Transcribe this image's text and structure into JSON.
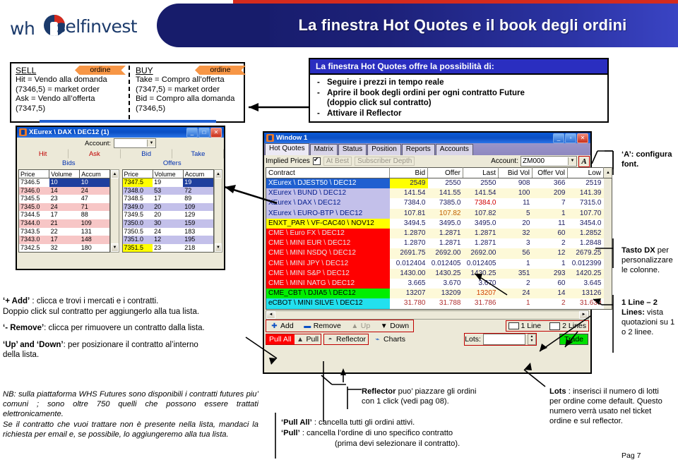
{
  "header": {
    "title": "La finestra Hot Quotes e il book degli ordini",
    "logo_wh": "wh",
    "logo_self": "selfinvest"
  },
  "sellbuy": {
    "left": {
      "heading": "SELL",
      "badge": "ordine",
      "lines": [
        "Hit = Vendo alla domanda",
        "(7346,5) = market order",
        "Ask = Vendo all’offerta",
        "(7347,5)"
      ]
    },
    "right": {
      "heading": "BUY",
      "badge": "ordine",
      "lines": [
        "Take = Compro all’offerta",
        "(7347,5) = market order",
        "Bid = Compro alla domanda",
        "(7346,5)"
      ]
    }
  },
  "infobox": {
    "title": "La finestra Hot Quotes offre la possibilità di:",
    "items": [
      "Seguire i prezzi in tempo reale",
      "Aprire il book degli ordini per ogni contratto Future",
      "(doppio click sul contratto)",
      "Attivare il Reflector"
    ]
  },
  "dax_window": {
    "title": "XEurex \\ DAX \\ DEC12 (1)",
    "min_label": "_",
    "max_label": "□",
    "close_label": "✕",
    "account_label": "Account:",
    "account_value": "",
    "action_buttons": [
      "Hit",
      "Ask",
      "Bid",
      "Take"
    ],
    "bids_label": "Bids",
    "offers_label": "Offers",
    "columns": [
      "Price",
      "Volume",
      "Accum"
    ],
    "bids": [
      {
        "price": "7346.5",
        "volume": "10",
        "accum": "10"
      },
      {
        "price": "7346.0",
        "volume": "14",
        "accum": "24"
      },
      {
        "price": "7345.5",
        "volume": "23",
        "accum": "47"
      },
      {
        "price": "7345.0",
        "volume": "24",
        "accum": "71"
      },
      {
        "price": "7344.5",
        "volume": "17",
        "accum": "88"
      },
      {
        "price": "7344.0",
        "volume": "21",
        "accum": "109"
      },
      {
        "price": "7343.5",
        "volume": "22",
        "accum": "131"
      },
      {
        "price": "7343.0",
        "volume": "17",
        "accum": "148"
      },
      {
        "price": "7342.5",
        "volume": "32",
        "accum": "180"
      }
    ],
    "offers": [
      {
        "price": "7347.5",
        "volume": "19",
        "accum": "19"
      },
      {
        "price": "7348.0",
        "volume": "53",
        "accum": "72"
      },
      {
        "price": "7348.5",
        "volume": "17",
        "accum": "89"
      },
      {
        "price": "7349.0",
        "volume": "20",
        "accum": "109"
      },
      {
        "price": "7349.5",
        "volume": "20",
        "accum": "129"
      },
      {
        "price": "7350.0",
        "volume": "30",
        "accum": "159"
      },
      {
        "price": "7350.5",
        "volume": "24",
        "accum": "183"
      },
      {
        "price": "7351.0",
        "volume": "12",
        "accum": "195"
      },
      {
        "price": "7351.5",
        "volume": "23",
        "accum": "218"
      }
    ]
  },
  "hot_quotes": {
    "title": "Window 1",
    "tabs": [
      "Hot Quotes",
      "Matrix",
      "Status",
      "Position",
      "Reports",
      "Accounts"
    ],
    "active_tab": "Hot Quotes",
    "implied_prices_label": "Implied Prices",
    "at_best_label": "At Best",
    "subscriber_depth_label": "Subscriber Depth",
    "account_label": "Account:",
    "account_value": "ZM000",
    "font_button": "A",
    "columns": [
      "Contract",
      "Bid",
      "Offer",
      "Last",
      "Bid Vol",
      "Offer Vol",
      "Low"
    ],
    "rows": [
      {
        "contract": "XEurex \\ DJEST50 \\ DEC12",
        "bid": "2549",
        "offer": "2550",
        "last": "2550",
        "bidvol": "908",
        "offervol": "366",
        "low": "2519",
        "color": "selected"
      },
      {
        "contract": "XEurex \\ BUND \\ DEC12",
        "bid": "141.54",
        "offer": "141.55",
        "last": "141.54",
        "bidvol": "100",
        "offervol": "209",
        "low": "141.39",
        "color": "lavender"
      },
      {
        "contract": "XEurex \\ DAX \\ DEC12",
        "bid": "7384.0",
        "offer": "7385.0",
        "last": "7384.0",
        "bidvol": "11",
        "offervol": "7",
        "low": "7315.0",
        "color": "lavender"
      },
      {
        "contract": "XEurex \\ EURO-BTP \\ DEC12",
        "bid": "107.81",
        "offer": "107.82",
        "last": "107.82",
        "bidvol": "5",
        "offervol": "1",
        "low": "107.70",
        "color": "lavender"
      },
      {
        "contract": "ENXT_PAR \\ VF-CAC40 \\ NOV12",
        "bid": "3494.5",
        "offer": "3495.0",
        "last": "3495.0",
        "bidvol": "20",
        "offervol": "11",
        "low": "3454.0",
        "color": "yellow"
      },
      {
        "contract": "CME \\ Euro FX \\ DEC12",
        "bid": "1.2870",
        "offer": "1.2871",
        "last": "1.2871",
        "bidvol": "32",
        "offervol": "60",
        "low": "1.2852",
        "color": "red"
      },
      {
        "contract": "CME \\ MINI EUR \\ DEC12",
        "bid": "1.2870",
        "offer": "1.2871",
        "last": "1.2871",
        "bidvol": "3",
        "offervol": "2",
        "low": "1.2848",
        "color": "red"
      },
      {
        "contract": "CME \\ MINI NSDQ \\ DEC12",
        "bid": "2691.75",
        "offer": "2692.00",
        "last": "2692.00",
        "bidvol": "56",
        "offervol": "12",
        "low": "2679.25",
        "color": "red"
      },
      {
        "contract": "CME \\ MINI JPY \\ DEC12",
        "bid": "0.012404",
        "offer": "0.012405",
        "last": "0.012405",
        "bidvol": "1",
        "offervol": "1",
        "low": "0.012399",
        "color": "red"
      },
      {
        "contract": "CME \\ MINI S&P \\ DEC12",
        "bid": "1430.00",
        "offer": "1430.25",
        "last": "1430.25",
        "bidvol": "351",
        "offervol": "293",
        "low": "1420.25",
        "color": "red"
      },
      {
        "contract": "CME \\ MINI NATG \\ DEC12",
        "bid": "3.665",
        "offer": "3.670",
        "last": "3.670",
        "bidvol": "2",
        "offervol": "60",
        "low": "3.645",
        "color": "red"
      },
      {
        "contract": "CME_CBT \\ DJIA5 \\ DEC12",
        "bid": "13207",
        "offer": "13209",
        "last": "13207",
        "bidvol": "24",
        "offervol": "14",
        "low": "13126",
        "color": "green"
      },
      {
        "contract": "eCBOT \\ MINI SILVE \\ DEC12",
        "bid": "31.780",
        "offer": "31.788",
        "last": "31.786",
        "bidvol": "1",
        "offervol": "2",
        "low": "31.630",
        "color": "cyan"
      }
    ],
    "toolbar_top": [
      {
        "icon": "plus-icon",
        "label": "Add",
        "disabled": false
      },
      {
        "icon": "minus-icon",
        "label": "Remove",
        "disabled": false
      },
      {
        "icon": "up-arrow-icon",
        "label": "Up",
        "disabled": true
      },
      {
        "icon": "down-arrow-icon",
        "label": "Down",
        "disabled": false
      }
    ],
    "line_buttons": [
      {
        "icon": "one-line-icon",
        "label": "1 Line"
      },
      {
        "icon": "two-lines-icon",
        "label": "2 Lines"
      }
    ],
    "toolbar_bottom": [
      {
        "icon": "pull-all-icon",
        "label": "Pull All"
      },
      {
        "icon": "pull-icon",
        "label": "Pull"
      },
      {
        "icon": "reflector-icon",
        "label": "Reflector"
      },
      {
        "icon": "charts-icon",
        "label": "Charts"
      }
    ],
    "lots_label": "Lots:",
    "lots_value": "",
    "trade_label": "Trade"
  },
  "annotations": {
    "add": {
      "bold": "‘+ Add’",
      "rest": " : clicca e trovi i mercati e i contratti.",
      "line2": "Doppio click sul contratto per aggiungerlo alla tua lista."
    },
    "remove": {
      "bold": "‘- Remove’",
      "rest": ":  clicca per rimuovere un contratto dalla lista."
    },
    "updown": {
      "bold": "‘Up’ and ‘Down’",
      "rest": ": per posizionare il contratto al’interno",
      "line2": "della lista."
    },
    "nb": "NB: sulla piattaforma WHS Futures sono disponibili i contratti futures piu’ comuni ; sono oltre 750 quelli che possono essere trattati elettronicamente.",
    "nb2": "Se il contratto che vuoi trattare non è presente nella lista, mandaci la richiesta per email e, se possibile, lo aggiungeremo alla tua lista.",
    "font_a": "‘A’: configura font.",
    "tasto_dx": {
      "bold": "Tasto DX",
      "rest": " per personalizzare le colonne."
    },
    "lines": {
      "bold": "1 Line – 2 Lines:",
      "rest": " vista quotazioni su 1 o 2 linee."
    },
    "reflector": {
      "bold": "Reflector",
      "rest": " puo’ piazzare gli ordini con 1 click (vedi pag 08)."
    },
    "pull_all": {
      "bold": "‘Pull All’",
      "rest": " : cancella tutti gli ordini attivi."
    },
    "pull": {
      "bold": "‘Pull’",
      "rest": " :  cancella l’ordine di uno specifico contratto",
      "line2": "(prima devi selezionare il contratto)."
    },
    "lots": {
      "bold": "Lots",
      "rest": " : inserisci il numero di lotti per ordine come default.",
      "line2": "Questo numero verrà usato nel ticket ordine e sul reflector."
    },
    "page": "Pag 7"
  }
}
